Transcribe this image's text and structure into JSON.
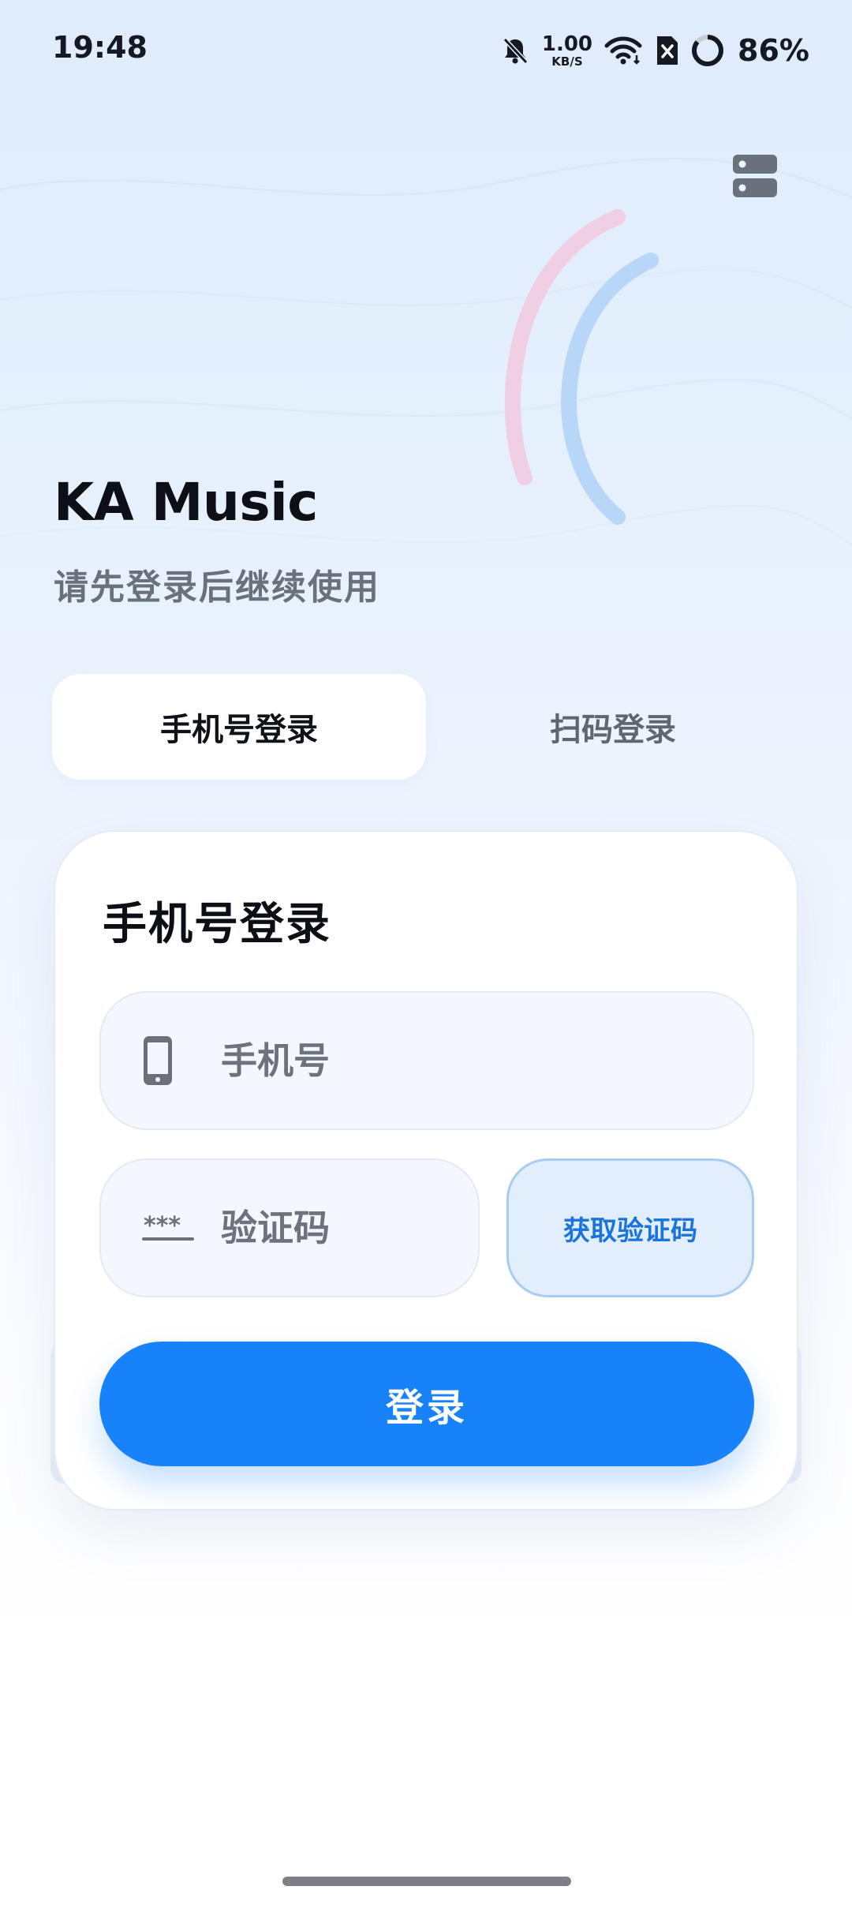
{
  "status_bar": {
    "time": "19:48",
    "net_speed_value": "1.00",
    "net_speed_unit": "KB/S",
    "battery": "86%",
    "icons": [
      "bell-muted-icon",
      "wifi-icon",
      "sim-off-icon",
      "battery-ring-icon"
    ]
  },
  "header": {
    "server_icon": "server-settings-icon"
  },
  "app": {
    "title": "KA Music",
    "subtitle": "请先登录后继续使用"
  },
  "tabs": [
    {
      "label": "手机号登录",
      "active": true
    },
    {
      "label": "扫码登录",
      "active": false
    }
  ],
  "form": {
    "title": "手机号登录",
    "phone_placeholder": "手机号",
    "phone_value": "",
    "code_placeholder": "验证码",
    "code_value": "",
    "get_code_label": "获取验证码",
    "login_label": "登录"
  },
  "colors": {
    "accent": "#1782fa",
    "accent_light": "#e3eefd",
    "arc_pink": "#f1cfe2",
    "arc_blue": "#b8d6f8"
  }
}
